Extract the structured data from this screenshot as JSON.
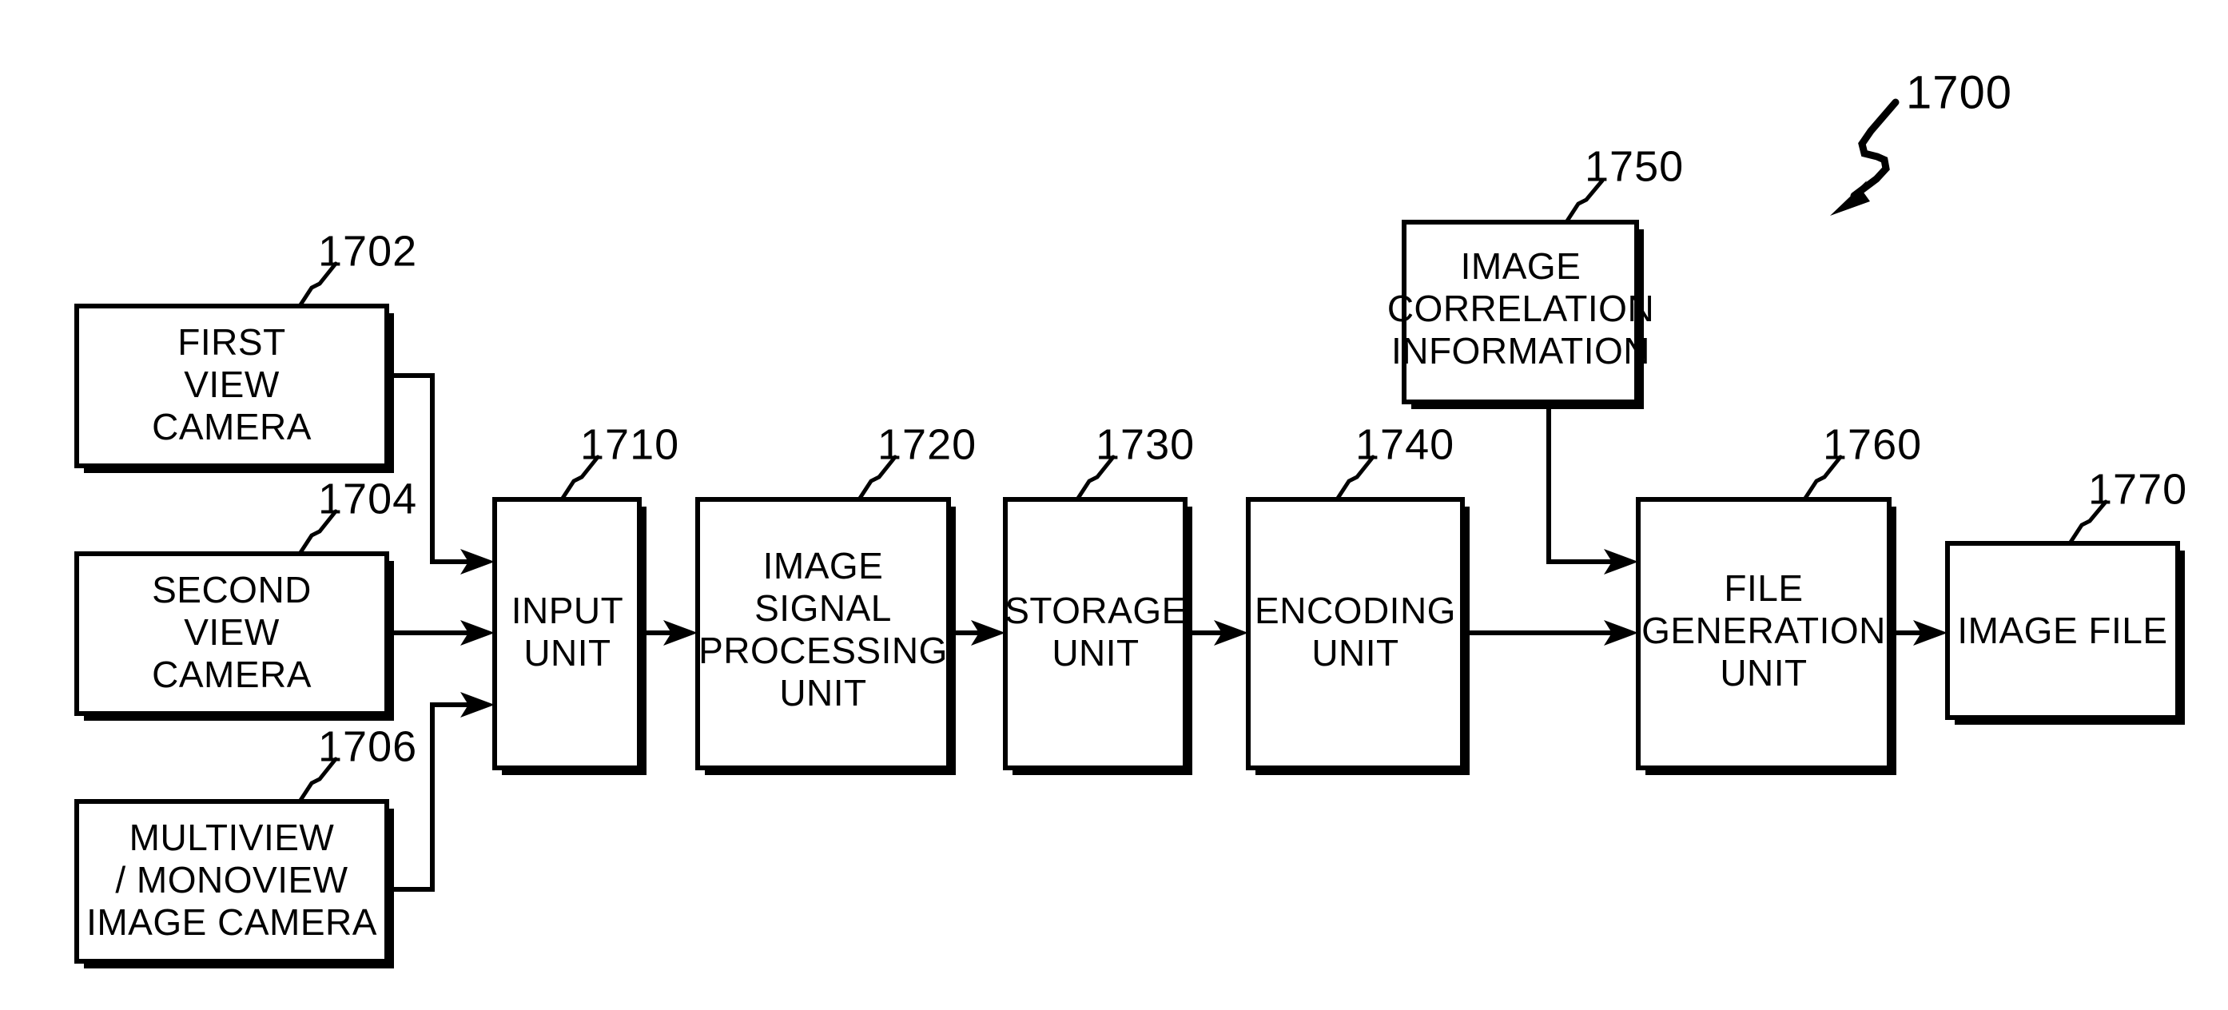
{
  "figure": {
    "figure_ref": "1700",
    "title_block_note": "Image capture, encoding and file generation system block diagram"
  },
  "blocks": [
    {
      "id": "first-view-camera",
      "ref": "1702",
      "lines": [
        "FIRST",
        "VIEW",
        "CAMERA"
      ]
    },
    {
      "id": "second-view-camera",
      "ref": "1704",
      "lines": [
        "SECOND",
        "VIEW",
        "CAMERA"
      ]
    },
    {
      "id": "multiview-monoview-image-camera",
      "ref": "1706",
      "lines": [
        "MULTIVIEW",
        "/ MONOVIEW",
        "IMAGE CAMERA"
      ]
    },
    {
      "id": "input-unit",
      "ref": "1710",
      "lines": [
        "INPUT",
        "UNIT"
      ]
    },
    {
      "id": "image-signal-processing-unit",
      "ref": "1720",
      "lines": [
        "IMAGE",
        "SIGNAL",
        "PROCESSING",
        "UNIT"
      ]
    },
    {
      "id": "storage-unit",
      "ref": "1730",
      "lines": [
        "STORAGE",
        "UNIT"
      ]
    },
    {
      "id": "encoding-unit",
      "ref": "1740",
      "lines": [
        "ENCODING",
        "UNIT"
      ]
    },
    {
      "id": "image-correlation-information",
      "ref": "1750",
      "lines": [
        "IMAGE",
        "CORRELATION",
        "INFORMATION"
      ]
    },
    {
      "id": "file-generation-unit",
      "ref": "1760",
      "lines": [
        "FILE",
        "GENERATION",
        "UNIT"
      ]
    },
    {
      "id": "image-file",
      "ref": "1770",
      "lines": [
        "IMAGE FILE"
      ]
    }
  ],
  "connections": [
    {
      "from": "first-view-camera",
      "to": "input-unit"
    },
    {
      "from": "second-view-camera",
      "to": "input-unit"
    },
    {
      "from": "multiview-monoview-image-camera",
      "to": "input-unit"
    },
    {
      "from": "input-unit",
      "to": "image-signal-processing-unit"
    },
    {
      "from": "image-signal-processing-unit",
      "to": "storage-unit"
    },
    {
      "from": "storage-unit",
      "to": "encoding-unit"
    },
    {
      "from": "encoding-unit",
      "to": "file-generation-unit"
    },
    {
      "from": "image-correlation-information",
      "to": "file-generation-unit"
    },
    {
      "from": "file-generation-unit",
      "to": "image-file"
    }
  ],
  "colors": {
    "background": "#ffffff",
    "stroke": "#000000",
    "text": "#000000"
  }
}
